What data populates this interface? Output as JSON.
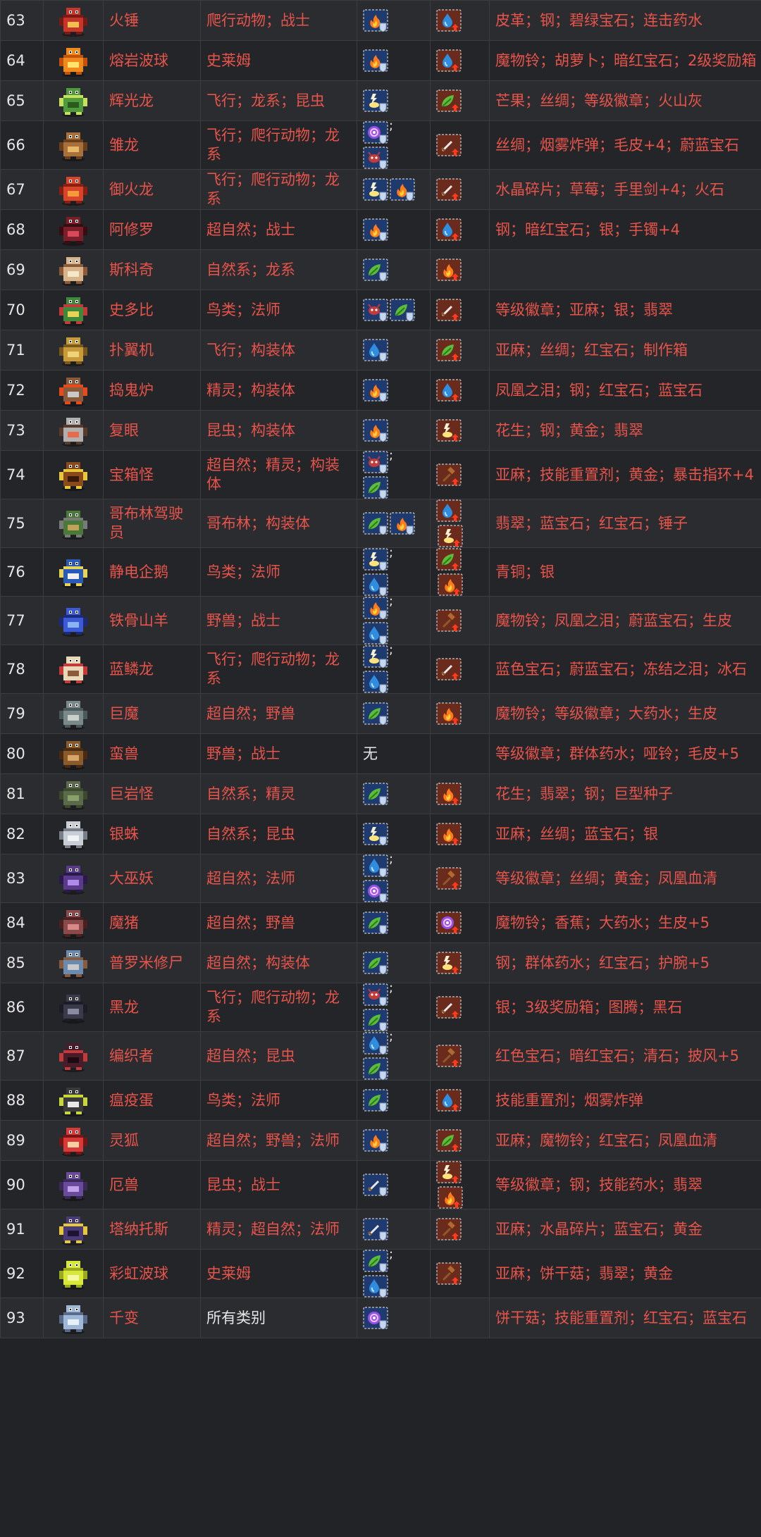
{
  "table": {
    "rows": [
      {
        "num": "63",
        "name": "火锤",
        "types": "爬行动物；战士",
        "resist": [
          [
            "fire"
          ]
        ],
        "weak": [
          "water"
        ],
        "materials": "皮革；钢；碧绿宝石；连击药水",
        "sprite": "red-reptile-warrior"
      },
      {
        "num": "64",
        "name": "熔岩波球",
        "types": "史莱姆",
        "resist": [
          [
            "fire"
          ]
        ],
        "weak": [
          "water"
        ],
        "materials": "魔物铃；胡萝卜；暗红宝石；2级奖励箱",
        "sprite": "orange-slime"
      },
      {
        "num": "65",
        "name": "辉光龙",
        "types": "飞行；龙系；昆虫",
        "resist": [
          [
            "electric"
          ]
        ],
        "weak": [
          "nature"
        ],
        "materials": "芒果；丝绸；等级徽章；火山灰",
        "sprite": "green-glow-dragon"
      },
      {
        "num": "66",
        "name": "雏龙",
        "types": "飞行；爬行动物；龙系",
        "resist": [
          [
            "mind"
          ],
          [
            "beast"
          ]
        ],
        "weak": [
          "sword"
        ],
        "materials": "丝绸；烟雾炸弹；毛皮+4；蔚蓝宝石",
        "sprite": "brown-winged-dragon"
      },
      {
        "num": "67",
        "name": "御火龙",
        "types": "飞行；爬行动物；龙系",
        "resist": [
          [
            "electric",
            "fire"
          ]
        ],
        "weak": [
          "sword"
        ],
        "materials": "水晶碎片；草莓；手里剑+4；火石",
        "sprite": "red-fire-dragon"
      },
      {
        "num": "68",
        "name": "阿修罗",
        "types": "超自然；战士",
        "resist": [
          [
            "fire"
          ]
        ],
        "weak": [
          "water"
        ],
        "materials": "钢；暗红宝石；银；手镯+4",
        "sprite": "dark-red-demon"
      },
      {
        "num": "69",
        "name": "斯科奇",
        "types": "自然系；龙系",
        "resist": [
          [
            "nature"
          ]
        ],
        "weak": [
          "fire"
        ],
        "materials": "",
        "sprite": "tan-fox-dragon"
      },
      {
        "num": "70",
        "name": "史多比",
        "types": "鸟类；法师",
        "resist": [
          [
            "beast",
            "nature"
          ]
        ],
        "weak": [
          "sword"
        ],
        "materials": "等级徽章；亚麻；银；翡翠",
        "sprite": "green-bird-mage"
      },
      {
        "num": "71",
        "name": "扑翼机",
        "types": "飞行；构装体",
        "resist": [
          [
            "water"
          ]
        ],
        "weak": [
          "nature"
        ],
        "materials": "亚麻；丝绸；红宝石；制作箱",
        "sprite": "golden-ornithopter"
      },
      {
        "num": "72",
        "name": "捣鬼炉",
        "types": "精灵；构装体",
        "resist": [
          [
            "fire"
          ]
        ],
        "weak": [
          "water"
        ],
        "materials": "凤凰之泪；钢；红宝石；蓝宝石",
        "sprite": "furnace-construct"
      },
      {
        "num": "73",
        "name": "复眼",
        "types": "昆虫；构装体",
        "resist": [
          [
            "fire"
          ]
        ],
        "weak": [
          "electric"
        ],
        "materials": "花生；钢；黄金；翡翠",
        "sprite": "eye-machine"
      },
      {
        "num": "74",
        "name": "宝箱怪",
        "types": "超自然；精灵；构装体",
        "resist": [
          [
            "beast"
          ],
          [
            "nature"
          ]
        ],
        "weak": [
          "hammer"
        ],
        "materials": "亚麻；技能重置剂；黄金；暴击指环+4",
        "sprite": "treasure-chest-mimic"
      },
      {
        "num": "75",
        "name": "哥布林驾驶员",
        "types": "哥布林；构装体",
        "resist": [
          [
            "nature",
            "fire"
          ]
        ],
        "weak": [
          "water",
          "electric"
        ],
        "materials": "翡翠；蓝宝石；红宝石；锤子",
        "sprite": "goblin-pilot"
      },
      {
        "num": "76",
        "name": "静电企鹅",
        "types": "鸟类；法师",
        "resist": [
          [
            "electric"
          ],
          [
            "water"
          ]
        ],
        "weak": [
          "nature",
          "fire"
        ],
        "materials": "青铜；银",
        "sprite": "blue-penguin"
      },
      {
        "num": "77",
        "name": "铁骨山羊",
        "types": "野兽；战士",
        "resist": [
          [
            "fire"
          ],
          [
            "water"
          ]
        ],
        "weak": [
          "hammer"
        ],
        "materials": "魔物铃；凤凰之泪；蔚蓝宝石；生皮",
        "sprite": "blue-goat-dragon"
      },
      {
        "num": "78",
        "name": "蓝鳞龙",
        "types": "飞行；爬行动物；龙系",
        "resist": [
          [
            "electric"
          ],
          [
            "water"
          ]
        ],
        "weak": [
          "sword"
        ],
        "materials": "蓝色宝石；蔚蓝宝石；冻结之泪；冰石",
        "sprite": "cream-fox-dragon"
      },
      {
        "num": "79",
        "name": "巨魔",
        "types": "超自然；野兽",
        "resist": [
          [
            "nature"
          ]
        ],
        "weak": [
          "fire"
        ],
        "materials": "魔物铃；等级徽章；大药水；生皮",
        "sprite": "grey-troll"
      },
      {
        "num": "80",
        "name": "蛮兽",
        "types": "野兽；战士",
        "resist_text": "无",
        "resist": [],
        "weak": [],
        "materials": "等级徽章；群体药水；哑铃；毛皮+5",
        "sprite": "brown-ape"
      },
      {
        "num": "81",
        "name": "巨岩怪",
        "types": "自然系；精灵",
        "resist": [
          [
            "nature"
          ]
        ],
        "weak": [
          "fire"
        ],
        "materials": "花生；翡翠；钢；巨型种子",
        "sprite": "rock-golem"
      },
      {
        "num": "82",
        "name": "银蛛",
        "types": "自然系；昆虫",
        "resist": [
          [
            "electric"
          ]
        ],
        "weak": [
          "fire"
        ],
        "materials": "亚麻；丝绸；蓝宝石；银",
        "sprite": "silver-spider"
      },
      {
        "num": "83",
        "name": "大巫妖",
        "types": "超自然；法师",
        "resist": [
          [
            "water"
          ],
          [
            "mind"
          ]
        ],
        "weak": [
          "hammer"
        ],
        "materials": "等级徽章；丝绸；黄金；凤凰血清",
        "sprite": "purple-lich"
      },
      {
        "num": "84",
        "name": "魔猪",
        "types": "超自然；野兽",
        "resist": [
          [
            "nature"
          ]
        ],
        "weak": [
          "mind"
        ],
        "materials": "魔物铃；香蕉；大药水；生皮+5",
        "sprite": "demon-pig"
      },
      {
        "num": "85",
        "name": "普罗米修尸",
        "types": "超自然；构装体",
        "resist": [
          [
            "nature"
          ]
        ],
        "weak": [
          "electric"
        ],
        "materials": "钢；群体药水；红宝石；护腕+5",
        "sprite": "zombie-construct"
      },
      {
        "num": "86",
        "name": "黑龙",
        "types": "飞行；爬行动物；龙系",
        "resist": [
          [
            "beast"
          ],
          [
            "nature"
          ]
        ],
        "weak": [
          "sword"
        ],
        "materials": "银；3级奖励箱；图腾；黑石",
        "sprite": "black-dragon"
      },
      {
        "num": "87",
        "name": "编织者",
        "types": "超自然；昆虫",
        "resist": [
          [
            "water"
          ],
          [
            "nature"
          ]
        ],
        "weak": [
          "hammer"
        ],
        "materials": "红色宝石；暗红宝石；清石；披风+5",
        "sprite": "weaver-spider"
      },
      {
        "num": "88",
        "name": "瘟疫蛋",
        "types": "鸟类；法师",
        "resist": [
          [
            "nature"
          ]
        ],
        "weak": [
          "water"
        ],
        "materials": "技能重置剂；烟雾炸弹",
        "sprite": "plague-egg"
      },
      {
        "num": "89",
        "name": "灵狐",
        "types": "超自然；野兽；法师",
        "resist": [
          [
            "fire"
          ]
        ],
        "weak": [
          "nature"
        ],
        "materials": "亚麻；魔物铃；红宝石；凤凰血清",
        "sprite": "red-spirit-fox"
      },
      {
        "num": "90",
        "name": "厄兽",
        "types": "昆虫；战士",
        "resist": [
          [
            "sword"
          ]
        ],
        "weak": [
          "electric",
          "fire"
        ],
        "materials": "等级徽章；钢；技能药水；翡翠",
        "sprite": "purple-beast"
      },
      {
        "num": "91",
        "name": "塔纳托斯",
        "types": "精灵；超自然；法师",
        "resist": [
          [
            "sword"
          ]
        ],
        "weak": [
          "hammer"
        ],
        "materials": "亚麻；水晶碎片；蓝宝石；黄金",
        "sprite": "thanatos-reaper"
      },
      {
        "num": "92",
        "name": "彩虹波球",
        "types": "史莱姆",
        "resist": [
          [
            "nature"
          ],
          [
            "water"
          ]
        ],
        "weak": [
          "hammer"
        ],
        "materials": "亚麻；饼干菇；翡翠；黄金",
        "sprite": "yellow-slime"
      },
      {
        "num": "93",
        "name": "千变",
        "types": "所有类别",
        "types_plain": true,
        "resist": [
          [
            "mind"
          ]
        ],
        "weak": [],
        "materials": "饼干菇；技能重置剂；红宝石；蓝宝石",
        "sprite": "shapeshifter"
      }
    ]
  },
  "icons": {
    "fire": "fire-icon",
    "water": "water-drop-icon",
    "nature": "leaf-icon",
    "electric": "lightning-icon",
    "mind": "mind-swirl-icon",
    "beast": "beast-claw-icon",
    "sword": "sword-icon",
    "hammer": "hammer-icon"
  },
  "colors": {
    "background": "#222326",
    "row_odd": "#2b2c30",
    "row_even": "#242528",
    "border": "#3b3d42",
    "accent_text": "#e8534a",
    "plain_text": "#e6e6e6",
    "resist_frame": "#1f3a6e",
    "weak_frame": "#6a2a1c"
  }
}
